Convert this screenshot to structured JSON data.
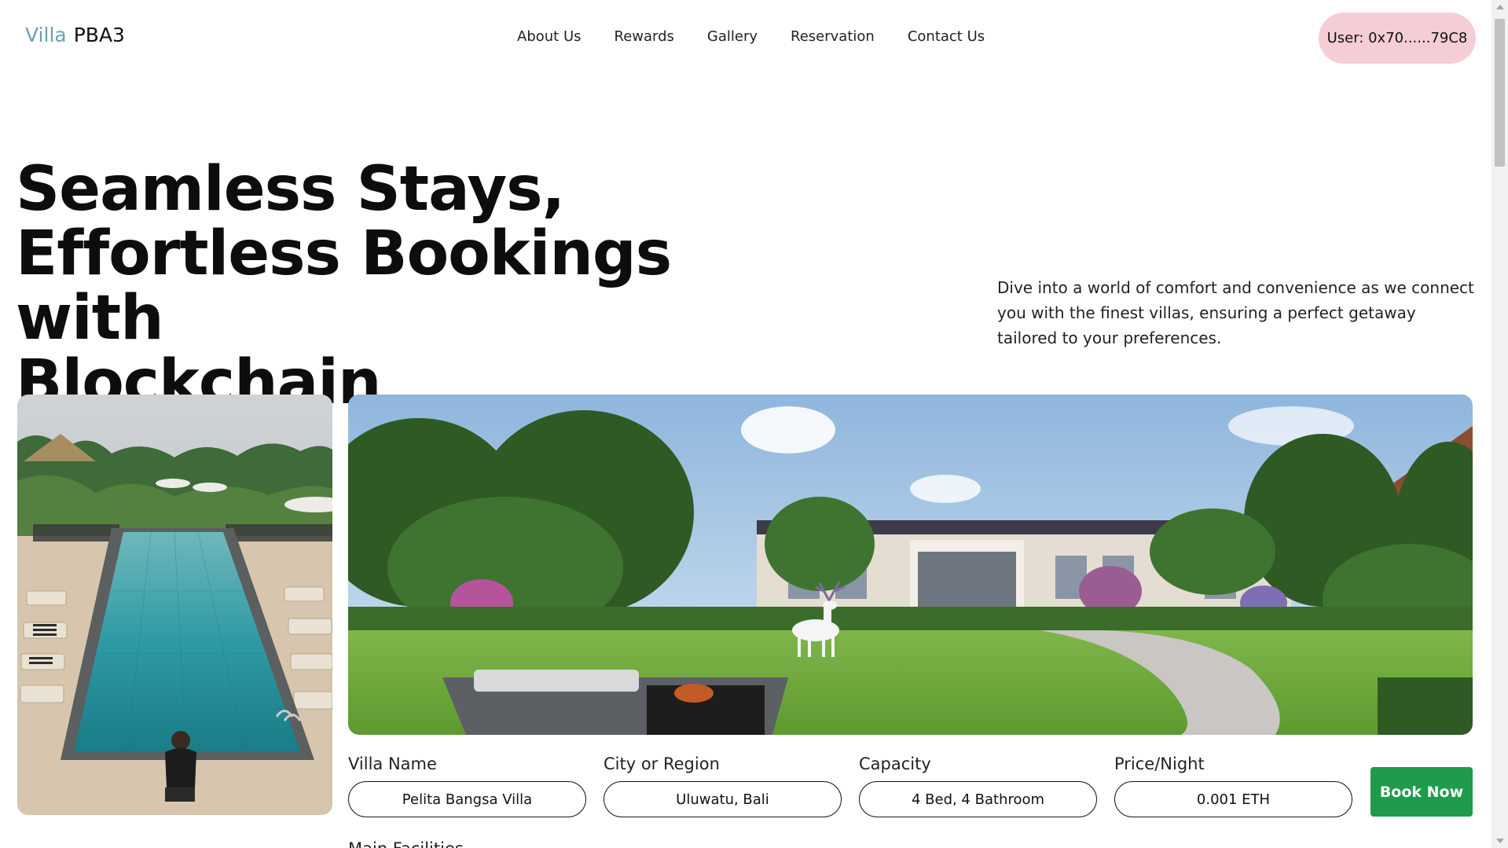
{
  "brand": {
    "part1": "Villa",
    "part2": "PBA3",
    "accent": "#6e9fb3"
  },
  "nav": {
    "items": [
      "About Us",
      "Rewards",
      "Gallery",
      "Reservation",
      "Contact Us"
    ]
  },
  "user": {
    "label": "User: 0x70......79C8",
    "pill_color": "#f5cdd5"
  },
  "hero": {
    "title_lines": [
      "Seamless Stays,",
      "Effortless Bookings with",
      "Blockchain"
    ],
    "description": "Dive into a world of comfort and convenience as we connect you with the finest villas, ensuring a perfect getaway tailored to your preferences."
  },
  "images": {
    "left": "pool-photo",
    "right": "villa-garden-photo"
  },
  "booking": {
    "fields": [
      {
        "label": "Villa Name",
        "value": "Pelita Bangsa Villa"
      },
      {
        "label": "City or Region",
        "value": "Uluwatu, Bali"
      },
      {
        "label": "Capacity",
        "value": "4 Bed, 4 Bathroom"
      },
      {
        "label": "Price/Night",
        "value": "0.001 ETH"
      }
    ],
    "button_label": "Book Now",
    "button_color": "#1f9b4b",
    "next_section": "Main Facilities"
  }
}
